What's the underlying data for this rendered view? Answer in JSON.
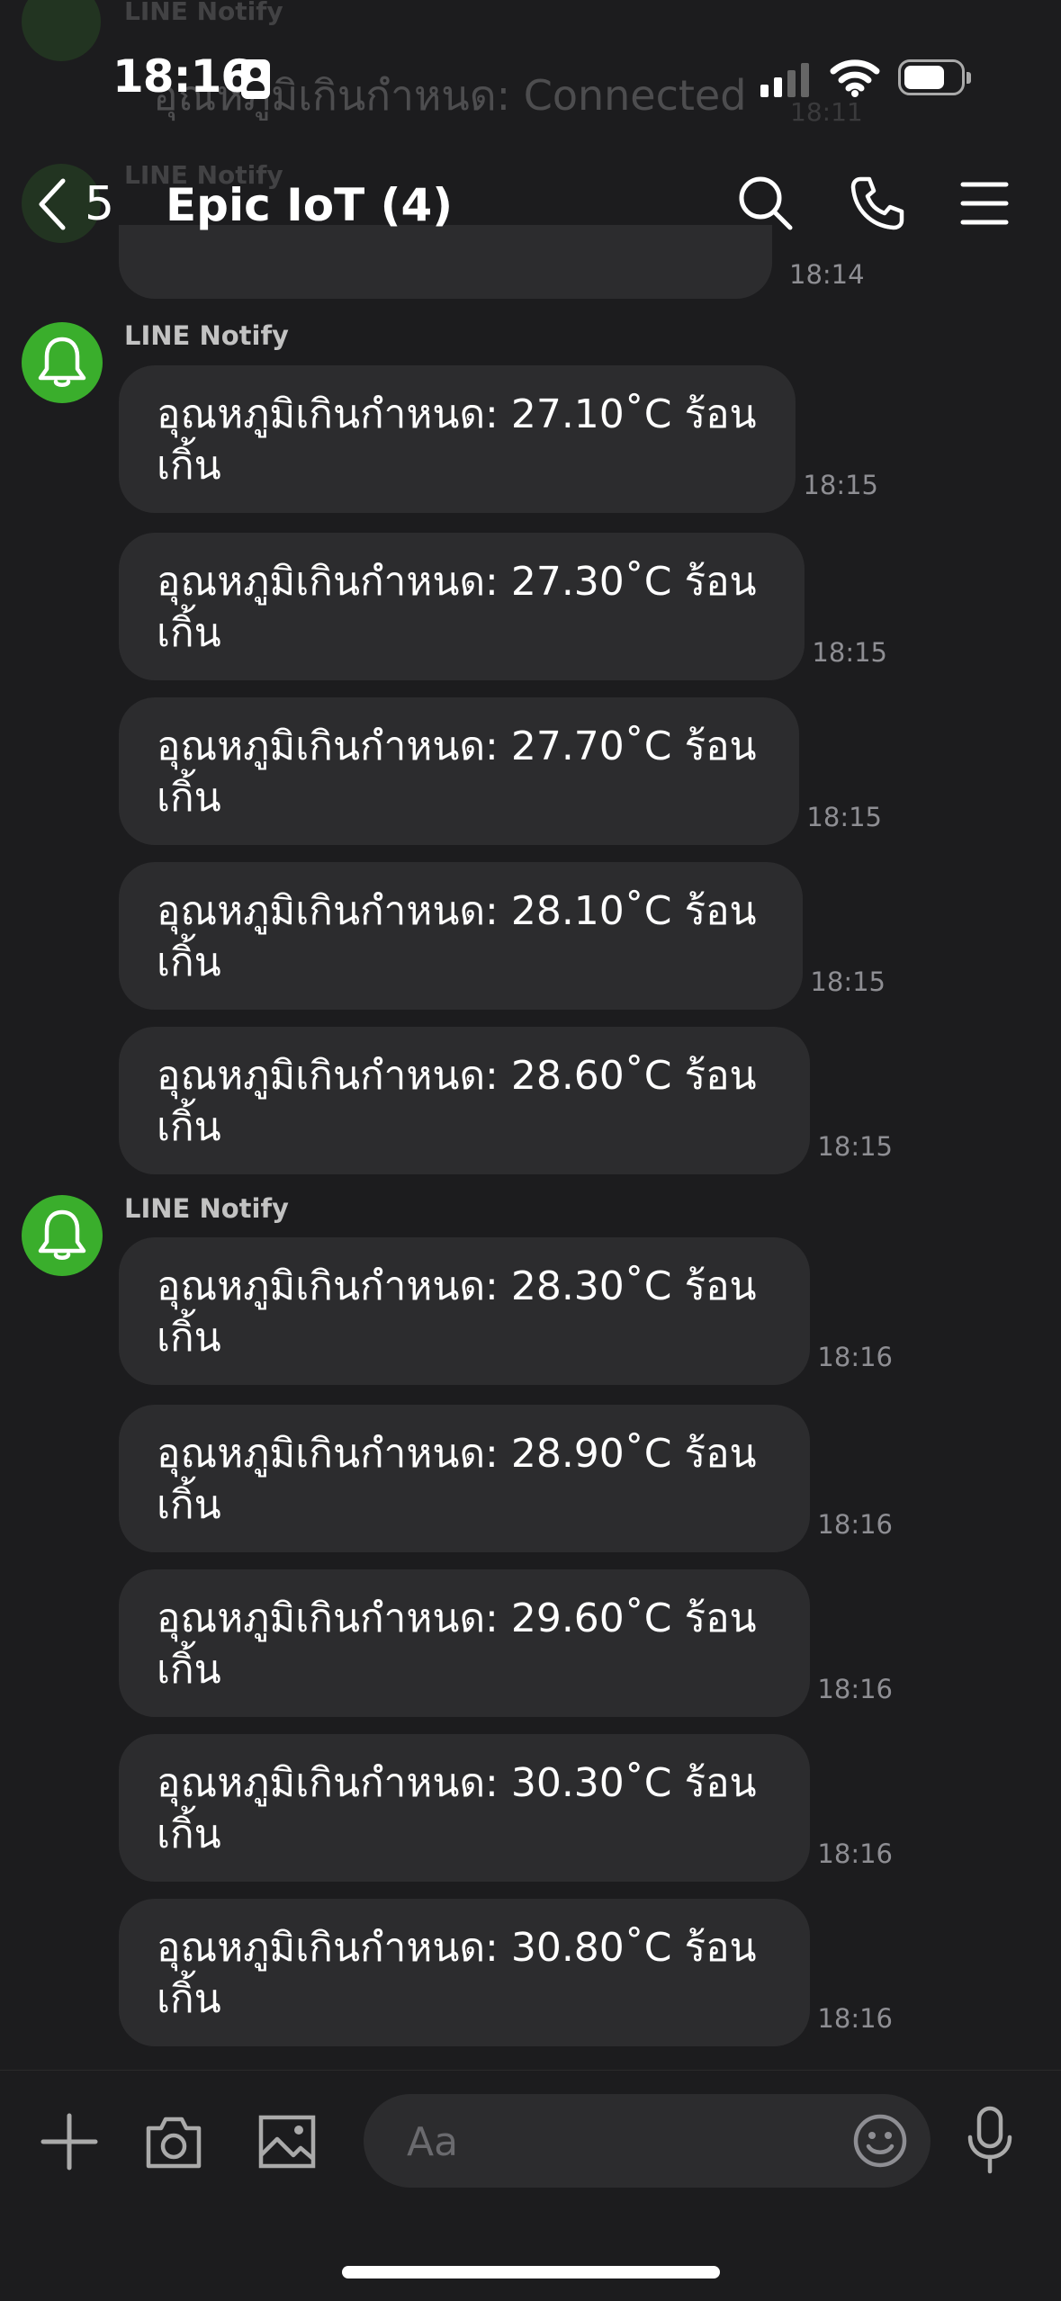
{
  "status_bar": {
    "time": "18:16"
  },
  "header": {
    "back_count": "5",
    "title": "Epic IoT (4)"
  },
  "ghost_behind": {
    "sender": "LINE Notify",
    "text": "อุณหภูมิเกินกำหนด: Connected",
    "time_a": "18:11",
    "time_b": "18:14"
  },
  "chat": {
    "groups": [
      {
        "sender": "LINE Notify",
        "messages": [
          {
            "text": "อุณหภูมิเกินกำหนด: 27.10˚C ร้อนเกิ้น",
            "time": "18:15"
          },
          {
            "text": "อุณหภูมิเกินกำหนด: 27.30˚C ร้อนเกิ้น",
            "time": "18:15"
          },
          {
            "text": "อุณหภูมิเกินกำหนด: 27.70˚C ร้อนเกิ้น",
            "time": "18:15"
          },
          {
            "text": "อุณหภูมิเกินกำหนด: 28.10˚C ร้อนเกิ้น",
            "time": "18:15"
          },
          {
            "text": "อุณหภูมิเกินกำหนด: 28.60˚C ร้อนเกิ้น",
            "time": "18:15"
          }
        ]
      },
      {
        "sender": "LINE Notify",
        "messages": [
          {
            "text": "อุณหภูมิเกินกำหนด: 28.30˚C ร้อนเกิ้น",
            "time": "18:16"
          },
          {
            "text": "อุณหภูมิเกินกำหนด: 28.90˚C ร้อนเกิ้น",
            "time": "18:16"
          },
          {
            "text": "อุณหภูมิเกินกำหนด: 29.60˚C ร้อนเกิ้น",
            "time": "18:16"
          },
          {
            "text": "อุณหภูมิเกินกำหนด: 30.30˚C ร้อนเกิ้น",
            "time": "18:16"
          },
          {
            "text": "อุณหภูมิเกินกำหนด: 30.80˚C ร้อนเกิ้น",
            "time": "18:16"
          }
        ]
      }
    ]
  },
  "composer": {
    "placeholder": "Aa"
  },
  "colors": {
    "line_green": "#3aae2c",
    "background": "#1c1c1e",
    "bubble": "#2c2c2e"
  }
}
